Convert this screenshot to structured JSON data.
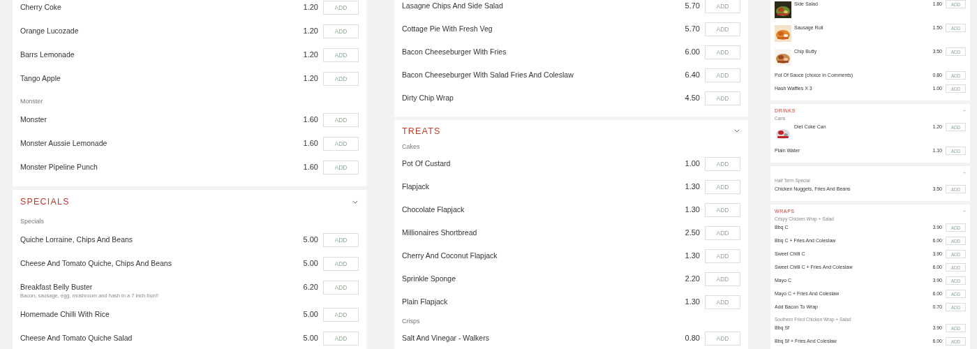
{
  "columns": [
    {
      "sections": [
        {
          "groups": [
            {
              "items": [
                {
                  "name": "Cherry Coke",
                  "price": "1.20",
                  "add": "ADD"
                },
                {
                  "name": "Orange Lucozade",
                  "price": "1.20",
                  "add": "ADD"
                },
                {
                  "name": "Barrs Lemonade",
                  "price": "1.20",
                  "add": "ADD"
                },
                {
                  "name": "Tango Apple",
                  "price": "1.20",
                  "add": "ADD"
                }
              ]
            },
            {
              "heading": "Monster",
              "items": [
                {
                  "name": "Monster",
                  "price": "1.60",
                  "add": "ADD"
                },
                {
                  "name": "Monster Aussie Lemonade",
                  "price": "1.60",
                  "add": "ADD"
                },
                {
                  "name": "Monster Pipeline Punch",
                  "price": "1.60",
                  "add": "ADD"
                }
              ]
            }
          ]
        },
        {
          "title": "SPECIALS",
          "collapsible": true,
          "groups": [
            {
              "heading": "Specials",
              "items": [
                {
                  "name": "Quiche Lorraine, Chips And Beans",
                  "price": "5.00",
                  "add": "ADD"
                },
                {
                  "name": "Cheese And Tomato Quiche, Chips And Beans",
                  "price": "5.00",
                  "add": "ADD"
                },
                {
                  "name": "Breakfast Belly Buster",
                  "description": "Bacon, sausage, egg, mushroom and hash in a 7 inch bun!!",
                  "price": "6.20",
                  "add": "ADD"
                },
                {
                  "name": "Homemade Chilli With Rice",
                  "price": "5.00",
                  "add": "ADD"
                },
                {
                  "name": "Cheese And Tomato Quiche Salad",
                  "price": "5.00",
                  "add": "ADD"
                }
              ]
            }
          ]
        }
      ]
    },
    {
      "sections": [
        {
          "groups": [
            {
              "items": [
                {
                  "name": "Lasagne Chips And Side Salad",
                  "price": "5.70",
                  "add": "ADD"
                },
                {
                  "name": "Cottage Pie With Fresh Veg",
                  "price": "5.70",
                  "add": "ADD"
                },
                {
                  "name": "Bacon Cheeseburger With Fries",
                  "price": "6.00",
                  "add": "ADD"
                },
                {
                  "name": "Bacon Cheeseburger With Salad Fries And Coleslaw",
                  "price": "6.40",
                  "add": "ADD"
                },
                {
                  "name": "Dirty Chip Wrap",
                  "price": "4.50",
                  "add": "ADD"
                }
              ]
            }
          ]
        },
        {
          "title": "TREATS",
          "collapsible": true,
          "groups": [
            {
              "heading": "Cakes",
              "items": [
                {
                  "name": "Pot Of Custard",
                  "price": "1.00",
                  "add": "ADD"
                },
                {
                  "name": "Flapjack",
                  "price": "1.30",
                  "add": "ADD"
                },
                {
                  "name": "Chocolate Flapjack",
                  "price": "1.30",
                  "add": "ADD"
                },
                {
                  "name": "Millionaires Shortbread",
                  "price": "2.50",
                  "add": "ADD"
                },
                {
                  "name": "Cherry And Coconut Flapjack",
                  "price": "1.30",
                  "add": "ADD"
                },
                {
                  "name": "Sprinkle Sponge",
                  "price": "2.20",
                  "add": "ADD"
                },
                {
                  "name": "Plain Flapjack",
                  "price": "1.30",
                  "add": "ADD"
                }
              ]
            },
            {
              "heading": "Crisps",
              "items": [
                {
                  "name": "Salt And Vinegar - Walkers",
                  "price": "0.80",
                  "add": "ADD"
                }
              ]
            }
          ]
        }
      ]
    },
    {
      "sections": [
        {
          "groups": [
            {
              "items": [
                {
                  "name": "Side Salad",
                  "price": "1.80",
                  "add": "ADD"
                },
                {
                  "name": "Sausage Roll",
                  "price": "1.50",
                  "add": "ADD"
                },
                {
                  "name": "Chip Butty",
                  "price": "3.50",
                  "add": "ADD"
                },
                {
                  "kind": "plain",
                  "name": "Pot Of Sauce (choice In Comments)",
                  "price": "0.80",
                  "add": "ADD"
                },
                {
                  "kind": "plain",
                  "name": "Hash Waffles X 3",
                  "price": "1.00",
                  "add": "ADD"
                }
              ]
            }
          ]
        },
        {
          "title": "DRINKS",
          "collapsible": true,
          "groups": [
            {
              "heading": "Cans",
              "items": [
                {
                  "name": "Diet Coke Can",
                  "price": "1.20",
                  "add": "ADD"
                },
                {
                  "kind": "plain",
                  "name": "Plain Water",
                  "price": "1.10",
                  "add": "ADD"
                }
              ]
            }
          ]
        },
        {
          "collapsible": true,
          "groups": [
            {
              "heading": "Half Term Special",
              "items": [
                {
                  "kind": "plain",
                  "name": "Chicken Nuggets, Fries And Beans",
                  "price": "3.50",
                  "add": "ADD"
                }
              ]
            }
          ]
        },
        {
          "title": "WRAPS",
          "collapsible": true,
          "groups": [
            {
              "heading": "Crispy Chicken Wrap + Salad",
              "items": [
                {
                  "kind": "plain",
                  "name": "Bbq C",
                  "price": "3.90",
                  "add": "ADD"
                },
                {
                  "kind": "plain",
                  "name": "Bbq C + Fries And Coleslaw",
                  "price": "6.00",
                  "add": "ADD"
                },
                {
                  "kind": "plain",
                  "name": "Sweet Chilli C",
                  "price": "3.90",
                  "add": "ADD"
                },
                {
                  "kind": "plain",
                  "name": "Sweet Chilli C + Fries And Coleslaw",
                  "price": "6.00",
                  "add": "ADD"
                },
                {
                  "kind": "plain",
                  "name": "Mayo C",
                  "price": "3.90",
                  "add": "ADD"
                },
                {
                  "kind": "plain",
                  "name": "Mayo C + Fries And Coleslaw",
                  "price": "6.00",
                  "add": "ADD"
                },
                {
                  "kind": "plain",
                  "name": "Add Bacon To Wrap",
                  "price": "0.70",
                  "add": "ADD"
                }
              ]
            },
            {
              "heading": "Southern Fried Chicken Wrap + Salad",
              "items": [
                {
                  "kind": "plain",
                  "name": "Bbq Sf",
                  "price": "3.90",
                  "add": "ADD"
                },
                {
                  "kind": "plain",
                  "name": "Bbq Sf + Fries And Coleslaw",
                  "price": "6.00",
                  "add": "ADD"
                }
              ]
            }
          ]
        }
      ]
    }
  ]
}
